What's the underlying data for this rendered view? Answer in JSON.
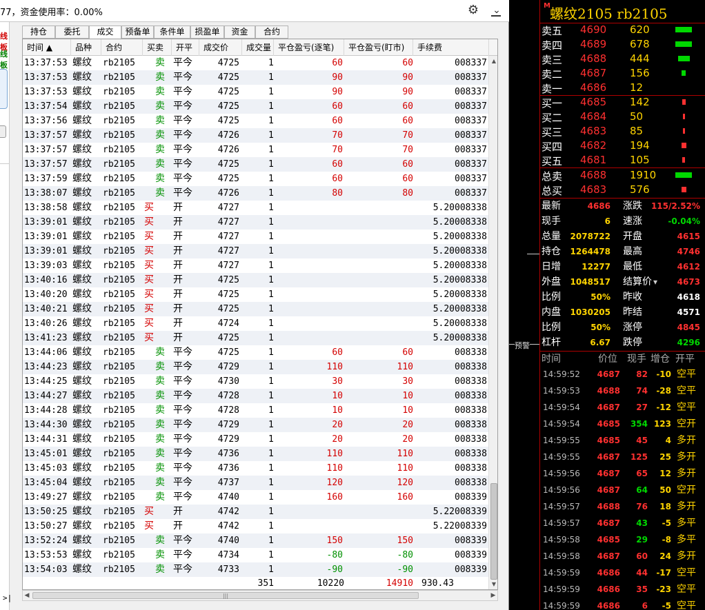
{
  "topbar": {
    "text": "77，资金使用率：0.00%"
  },
  "sidebar": {
    "red_label": "线板",
    "green_label": "线板"
  },
  "tabs": [
    "持仓",
    "委托",
    "成交",
    "预备单",
    "条件单",
    "损盈单",
    "资金",
    "合约"
  ],
  "active_tab": "成交",
  "columns": [
    "时间 ▲",
    "品种",
    "合约",
    "买卖",
    "开平",
    "成交价",
    "成交量",
    "平仓盈亏(逐笔)",
    "平仓盈亏(盯市)",
    "手续费"
  ],
  "trades": [
    [
      "13:37:53",
      "螺纹",
      "rb2105",
      "卖",
      "平今",
      "4725",
      "1",
      "60",
      "60",
      "",
      "008337"
    ],
    [
      "13:37:53",
      "螺纹",
      "rb2105",
      "卖",
      "平今",
      "4725",
      "1",
      "90",
      "90",
      "",
      "008337"
    ],
    [
      "13:37:53",
      "螺纹",
      "rb2105",
      "卖",
      "平今",
      "4725",
      "1",
      "90",
      "90",
      "",
      "008337"
    ],
    [
      "13:37:54",
      "螺纹",
      "rb2105",
      "卖",
      "平今",
      "4725",
      "1",
      "60",
      "60",
      "",
      "008337"
    ],
    [
      "13:37:56",
      "螺纹",
      "rb2105",
      "卖",
      "平今",
      "4725",
      "1",
      "60",
      "60",
      "",
      "008337"
    ],
    [
      "13:37:57",
      "螺纹",
      "rb2105",
      "卖",
      "平今",
      "4726",
      "1",
      "70",
      "70",
      "",
      "008337"
    ],
    [
      "13:37:57",
      "螺纹",
      "rb2105",
      "卖",
      "平今",
      "4726",
      "1",
      "70",
      "70",
      "",
      "008337"
    ],
    [
      "13:37:57",
      "螺纹",
      "rb2105",
      "卖",
      "平今",
      "4725",
      "1",
      "60",
      "60",
      "",
      "008337"
    ],
    [
      "13:37:59",
      "螺纹",
      "rb2105",
      "卖",
      "平今",
      "4725",
      "1",
      "60",
      "60",
      "",
      "008337"
    ],
    [
      "13:38:07",
      "螺纹",
      "rb2105",
      "卖",
      "平今",
      "4726",
      "1",
      "80",
      "80",
      "",
      "008337"
    ],
    [
      "13:38:58",
      "螺纹",
      "rb2105",
      "买",
      "开",
      "4727",
      "1",
      "",
      "",
      "5.20",
      "008338"
    ],
    [
      "13:39:01",
      "螺纹",
      "rb2105",
      "买",
      "开",
      "4727",
      "1",
      "",
      "",
      "5.20",
      "008338"
    ],
    [
      "13:39:01",
      "螺纹",
      "rb2105",
      "买",
      "开",
      "4727",
      "1",
      "",
      "",
      "5.20",
      "008338"
    ],
    [
      "13:39:01",
      "螺纹",
      "rb2105",
      "买",
      "开",
      "4727",
      "1",
      "",
      "",
      "5.20",
      "008338"
    ],
    [
      "13:39:03",
      "螺纹",
      "rb2105",
      "买",
      "开",
      "4727",
      "1",
      "",
      "",
      "5.20",
      "008338"
    ],
    [
      "13:40:16",
      "螺纹",
      "rb2105",
      "买",
      "开",
      "4725",
      "1",
      "",
      "",
      "5.20",
      "008338"
    ],
    [
      "13:40:20",
      "螺纹",
      "rb2105",
      "买",
      "开",
      "4725",
      "1",
      "",
      "",
      "5.20",
      "008338"
    ],
    [
      "13:40:21",
      "螺纹",
      "rb2105",
      "买",
      "开",
      "4725",
      "1",
      "",
      "",
      "5.20",
      "008338"
    ],
    [
      "13:40:26",
      "螺纹",
      "rb2105",
      "买",
      "开",
      "4724",
      "1",
      "",
      "",
      "5.20",
      "008338"
    ],
    [
      "13:41:23",
      "螺纹",
      "rb2105",
      "买",
      "开",
      "4725",
      "1",
      "",
      "",
      "5.20",
      "008338"
    ],
    [
      "13:44:06",
      "螺纹",
      "rb2105",
      "卖",
      "平今",
      "4725",
      "1",
      "60",
      "60",
      "",
      "008338"
    ],
    [
      "13:44:23",
      "螺纹",
      "rb2105",
      "卖",
      "平今",
      "4729",
      "1",
      "110",
      "110",
      "",
      "008338"
    ],
    [
      "13:44:25",
      "螺纹",
      "rb2105",
      "卖",
      "平今",
      "4730",
      "1",
      "30",
      "30",
      "",
      "008338"
    ],
    [
      "13:44:27",
      "螺纹",
      "rb2105",
      "卖",
      "平今",
      "4728",
      "1",
      "10",
      "10",
      "",
      "008338"
    ],
    [
      "13:44:28",
      "螺纹",
      "rb2105",
      "卖",
      "平今",
      "4728",
      "1",
      "10",
      "10",
      "",
      "008338"
    ],
    [
      "13:44:30",
      "螺纹",
      "rb2105",
      "卖",
      "平今",
      "4729",
      "1",
      "20",
      "20",
      "",
      "008338"
    ],
    [
      "13:44:31",
      "螺纹",
      "rb2105",
      "卖",
      "平今",
      "4729",
      "1",
      "20",
      "20",
      "",
      "008338"
    ],
    [
      "13:45:01",
      "螺纹",
      "rb2105",
      "卖",
      "平今",
      "4736",
      "1",
      "110",
      "110",
      "",
      "008338"
    ],
    [
      "13:45:03",
      "螺纹",
      "rb2105",
      "卖",
      "平今",
      "4736",
      "1",
      "110",
      "110",
      "",
      "008338"
    ],
    [
      "13:45:04",
      "螺纹",
      "rb2105",
      "卖",
      "平今",
      "4737",
      "1",
      "120",
      "120",
      "",
      "008338"
    ],
    [
      "13:49:27",
      "螺纹",
      "rb2105",
      "卖",
      "平今",
      "4740",
      "1",
      "160",
      "160",
      "",
      "008339"
    ],
    [
      "13:50:25",
      "螺纹",
      "rb2105",
      "买",
      "开",
      "4742",
      "1",
      "",
      "",
      "5.22",
      "008339"
    ],
    [
      "13:50:27",
      "螺纹",
      "rb2105",
      "买",
      "开",
      "4742",
      "1",
      "",
      "",
      "5.22",
      "008339"
    ],
    [
      "13:52:24",
      "螺纹",
      "rb2105",
      "卖",
      "平今",
      "4740",
      "1",
      "150",
      "150",
      "",
      "008339"
    ],
    [
      "13:53:53",
      "螺纹",
      "rb2105",
      "卖",
      "平今",
      "4734",
      "1",
      "-80",
      "-80",
      "",
      "008339"
    ],
    [
      "13:54:03",
      "螺纹",
      "rb2105",
      "卖",
      "平今",
      "4733",
      "1",
      "-90",
      "-90",
      "",
      "008339"
    ]
  ],
  "totals": {
    "volume": "351",
    "pnl_trade": "10220",
    "pnl_mark": "14910",
    "fee": "930.43"
  },
  "chart_strip": {
    "warn_label": "预警"
  },
  "quote": {
    "marker": "M",
    "title": "螺纹2105  rb2105",
    "asks": [
      {
        "label": "卖五",
        "price": "4690",
        "vol": "620",
        "bar": 1.0
      },
      {
        "label": "卖四",
        "price": "4689",
        "vol": "678",
        "bar": 1.0
      },
      {
        "label": "卖三",
        "price": "4688",
        "vol": "444",
        "bar": 0.7
      },
      {
        "label": "卖二",
        "price": "4687",
        "vol": "156",
        "bar": 0.25
      },
      {
        "label": "卖一",
        "price": "4686",
        "vol": "12",
        "bar": 0
      }
    ],
    "bids": [
      {
        "label": "买一",
        "price": "4685",
        "vol": "142",
        "bar": 0.22
      },
      {
        "label": "买二",
        "price": "4684",
        "vol": "50",
        "bar": 0.08
      },
      {
        "label": "买三",
        "price": "4683",
        "vol": "85",
        "bar": 0.14
      },
      {
        "label": "买四",
        "price": "4682",
        "vol": "194",
        "bar": 0.3
      },
      {
        "label": "买五",
        "price": "4681",
        "vol": "105",
        "bar": 0.17
      }
    ],
    "totals": [
      {
        "label": "总卖",
        "price": "4688",
        "vol": "1910",
        "bar": 1.0,
        "color": "#00d800"
      },
      {
        "label": "总买",
        "price": "4683",
        "vol": "576",
        "bar": 0.3,
        "color": "#ff3030"
      }
    ],
    "stats": [
      [
        "最新",
        "4686",
        "涨跌",
        "115/2.52%"
      ],
      [
        "现手",
        "6",
        "速涨",
        "-0.04%"
      ],
      [
        "总量",
        "2078722",
        "开盘",
        "4615"
      ],
      [
        "持仓",
        "1264478",
        "最高",
        "4746"
      ],
      [
        "日增",
        "12277",
        "最低",
        "4612"
      ],
      [
        "外盘",
        "1048517",
        "结算价",
        "4673"
      ],
      [
        "比例",
        "50%",
        "昨收",
        "4618"
      ],
      [
        "内盘",
        "1030205",
        "昨结",
        "4571"
      ],
      [
        "比例",
        "50%",
        "涨停",
        "4845"
      ],
      [
        "杠杆",
        "6.67",
        "跌停",
        "4296"
      ]
    ],
    "stat_colors": [
      [
        "#ff3030",
        "#ff3030"
      ],
      [
        "#ffd400",
        "#00d800"
      ],
      [
        "#ffd400",
        "#ff3030"
      ],
      [
        "#ffd400",
        "#ff3030"
      ],
      [
        "#ffd400",
        "#ff3030"
      ],
      [
        "#ffd400",
        "#ff3030"
      ],
      [
        "#ffd400",
        "#ffffff"
      ],
      [
        "#ffd400",
        "#ffffff"
      ],
      [
        "#ffd400",
        "#ff3030"
      ],
      [
        "#ffd400",
        "#00d800"
      ]
    ],
    "ts_headers": [
      "时间",
      "价位",
      "现手",
      "增仓",
      "开平"
    ],
    "ticks": [
      [
        "14:59:52",
        "4687",
        "82",
        "-10",
        "空平"
      ],
      [
        "14:59:53",
        "4688",
        "74",
        "-28",
        "空平"
      ],
      [
        "14:59:54",
        "4687",
        "27",
        "-12",
        "空平"
      ],
      [
        "14:59:54",
        "4685",
        "354",
        "123",
        "空开"
      ],
      [
        "14:59:55",
        "4685",
        "45",
        "4",
        "多开"
      ],
      [
        "14:59:55",
        "4687",
        "125",
        "25",
        "多开"
      ],
      [
        "14:59:56",
        "4687",
        "65",
        "12",
        "多开"
      ],
      [
        "14:59:56",
        "4687",
        "64",
        "50",
        "空开"
      ],
      [
        "14:59:57",
        "4688",
        "76",
        "18",
        "多开"
      ],
      [
        "14:59:57",
        "4687",
        "43",
        "-5",
        "多平"
      ],
      [
        "14:59:58",
        "4685",
        "29",
        "-8",
        "多平"
      ],
      [
        "14:59:58",
        "4687",
        "60",
        "24",
        "多开"
      ],
      [
        "14:59:59",
        "4686",
        "44",
        "-17",
        "空平"
      ],
      [
        "14:59:59",
        "4686",
        "35",
        "-23",
        "空平"
      ],
      [
        "14:59:59",
        "4686",
        "6",
        "-5",
        "空平"
      ]
    ],
    "tick_colors": [
      [
        "#ff3030",
        "#ff3030"
      ],
      [
        "#ff3030",
        "#ff3030"
      ],
      [
        "#ff3030",
        "#ff3030"
      ],
      [
        "#ff3030",
        "#00d800"
      ],
      [
        "#ff3030",
        "#ff3030"
      ],
      [
        "#ff3030",
        "#ff3030"
      ],
      [
        "#ff3030",
        "#ff3030"
      ],
      [
        "#ff3030",
        "#00d800"
      ],
      [
        "#ff3030",
        "#ff3030"
      ],
      [
        "#ff3030",
        "#00d800"
      ],
      [
        "#ff3030",
        "#00d800"
      ],
      [
        "#ff3030",
        "#ff3030"
      ],
      [
        "#ff3030",
        "#ff3030"
      ],
      [
        "#ff3030",
        "#ff3030"
      ],
      [
        "#ff3030",
        "#ff3030"
      ]
    ]
  }
}
